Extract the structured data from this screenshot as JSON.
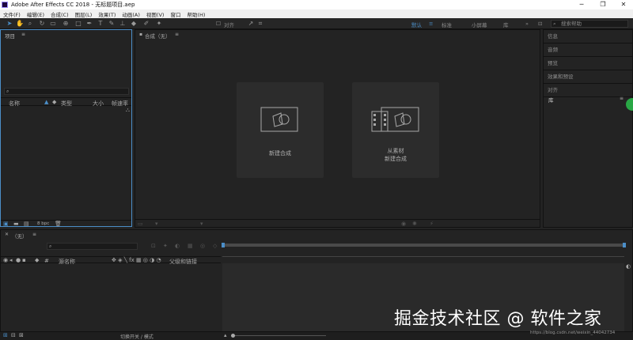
{
  "window": {
    "title": "Adobe After Effects CC 2018 - 无标题项目.aep",
    "minimize": "─",
    "maximize": "❐",
    "close": "✕"
  },
  "menu": [
    "文件(F)",
    "编辑(E)",
    "合成(C)",
    "图层(L)",
    "效果(T)",
    "动画(A)",
    "视图(V)",
    "窗口",
    "帮助(H)"
  ],
  "toolbar": {
    "align_label": "对齐",
    "workspaces": [
      "默认",
      "标准",
      "小屏幕",
      "库"
    ],
    "active_workspace": "默认",
    "search_placeholder": "搜索帮助"
  },
  "project_panel": {
    "title": "项目",
    "columns": [
      "名称",
      "类型",
      "大小",
      "帧速率"
    ],
    "bpc": "8 bpc"
  },
  "comp_panel": {
    "tab_label": "合成（无）",
    "new_comp": "新建合成",
    "from_footage_line1": "从素材",
    "from_footage_line2": "新建合成"
  },
  "right_panel": {
    "items": [
      "信息",
      "音频",
      "预览",
      "效果和预设",
      "对齐"
    ],
    "library": "库"
  },
  "timeline": {
    "tab_label": "（无）",
    "source_name": "源名称",
    "parent_link": "父级和链接"
  },
  "status": {
    "toggle_label": "切换开关 / 模式"
  },
  "watermark": "掘金技术社区 @ 软件之家",
  "credit": "https://blog.csdn.net/weixin_44042734",
  "colors": {
    "accent": "#4b8ec8",
    "bg": "#232323",
    "panel_border": "#111111"
  }
}
